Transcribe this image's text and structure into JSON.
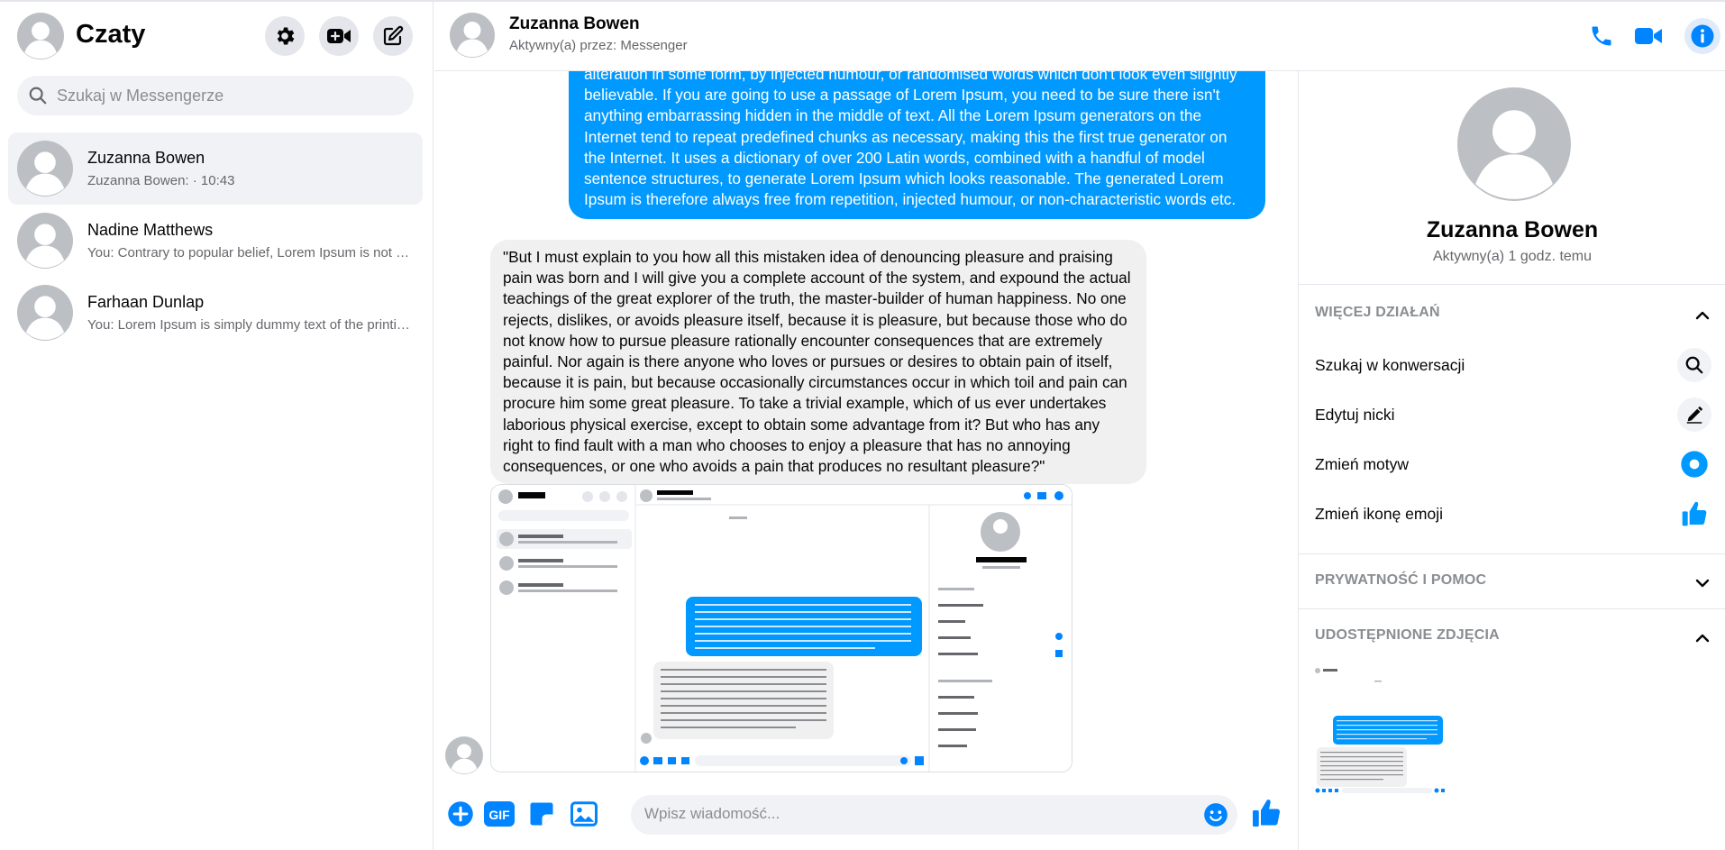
{
  "sidebar": {
    "title": "Czaty",
    "search_placeholder": "Szukaj w Messengerze",
    "chats": [
      {
        "name": "Zuzanna Bowen",
        "preview": "Zuzanna Bowen: · 10:43"
      },
      {
        "name": "Nadine Matthews",
        "preview": "You: Contrary to popular belief, Lorem Ipsum is not simply random text."
      },
      {
        "name": "Farhaan Dunlap",
        "preview": "You: Lorem Ipsum is simply dummy text of the printing and typesetting industry."
      }
    ]
  },
  "header": {
    "name": "Zuzanna Bowen",
    "status": "Aktywny(a) przez: Messenger"
  },
  "messages": {
    "outgoing_text": "alteration in some form, by injected humour, or randomised words which don't look even slightly believable. If you are going to use a passage of Lorem Ipsum, you need to be sure there isn't anything embarrassing hidden in the middle of text. All the Lorem Ipsum generators on the Internet tend to repeat predefined chunks as necessary, making this the first true generator on the Internet. It uses a dictionary of over 200 Latin words, combined with a handful of model sentence structures, to generate Lorem Ipsum which looks reasonable. The generated Lorem Ipsum is therefore always free from repetition, injected humour, or non-characteristic words etc.",
    "incoming_text": "\"But I must explain to you how all this mistaken idea of denouncing pleasure and praising pain was born and I will give you a complete account of the system, and expound the actual teachings of the great explorer of the truth, the master-builder of human happiness. No one rejects, dislikes, or avoids pleasure itself, because it is pleasure, but because those who do not know how to pursue pleasure rationally encounter consequences that are extremely painful. Nor again is there anyone who loves or pursues or desires to obtain pain of itself, because it is pain, but because occasionally circumstances occur in which toil and pain can procure him some great pleasure. To take a trivial example, which of us ever undertakes laborious physical exercise, except to obtain some advantage from it? But who has any right to find fault with a man who chooses to enjoy a pleasure that has no annoying consequences, or one who avoids a pain that produces no resultant pleasure?\""
  },
  "composer": {
    "placeholder": "Wpisz wiadomość...",
    "gif_label": "GIF"
  },
  "right_panel": {
    "name": "Zuzanna Bowen",
    "status": "Aktywny(a) 1 godz. temu",
    "section_more": "WIĘCEJ DZIAŁAŃ",
    "actions": [
      {
        "label": "Szukaj w konwersacji",
        "icon": "search-icon"
      },
      {
        "label": "Edytuj nicki",
        "icon": "pencil-icon"
      },
      {
        "label": "Zmień motyw",
        "icon": "theme-circle-icon"
      },
      {
        "label": "Zmień ikonę emoji",
        "icon": "thumbs-up-icon"
      }
    ],
    "section_privacy": "PRYWATNOŚĆ I POMOC",
    "section_photos": "UDOSTĘPNIONE ZDJĘCIA"
  },
  "colors": {
    "accent": "#0099ff",
    "icon_blue": "#0084ff",
    "bubble_in": "#f0f0f0",
    "avatar_bg": "#bcc0c4"
  }
}
